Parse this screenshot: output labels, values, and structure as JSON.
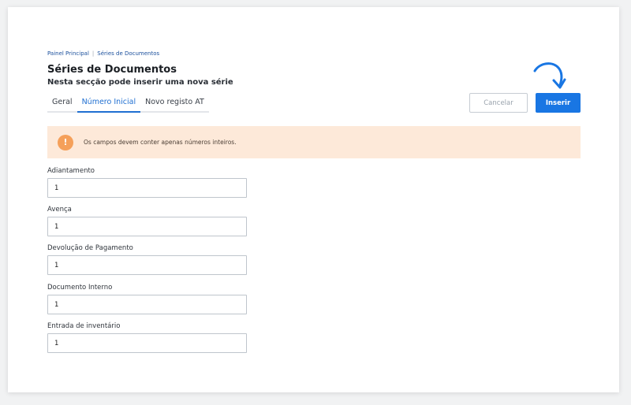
{
  "breadcrumb": {
    "home": "Painel Principal",
    "separator": "|",
    "current": "Séries de Documentos"
  },
  "page": {
    "title": "Séries de Documentos",
    "subtitle": "Nesta secção pode inserir uma nova série"
  },
  "tabs": [
    {
      "label": "Geral"
    },
    {
      "label": "Número Inicial",
      "active": true
    },
    {
      "label": "Novo registo AT"
    }
  ],
  "buttons": {
    "cancel_label": "Cancelar",
    "insert_label": "Inserir"
  },
  "alert": {
    "icon": "!",
    "text": "Os campos devem conter apenas números inteiros."
  },
  "fields": [
    {
      "label": "Adiantamento",
      "value": "1"
    },
    {
      "label": "Avença",
      "value": "1"
    },
    {
      "label": "Devolução de Pagamento",
      "value": "1"
    },
    {
      "label": "Documento Interno",
      "value": "1"
    },
    {
      "label": "Entrada de inventário",
      "value": "1"
    }
  ],
  "colors": {
    "accent": "#1976e3",
    "alert_background": "#fde9d9",
    "alert_icon": "#f5a05a"
  }
}
